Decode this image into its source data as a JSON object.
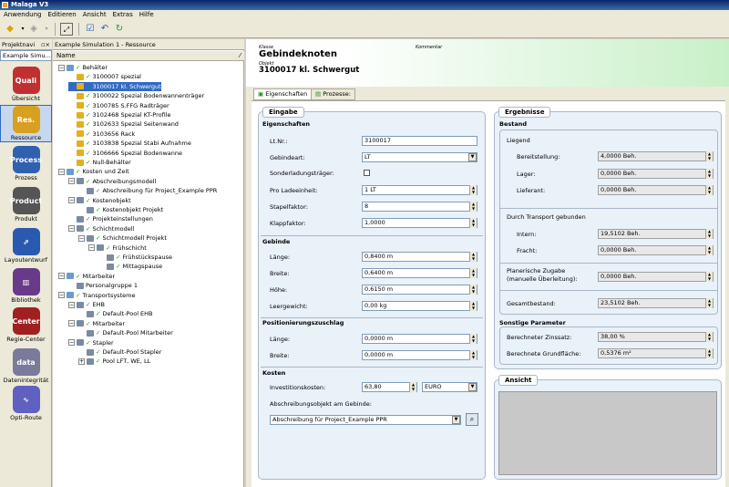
{
  "app": {
    "title": "Malaga V3"
  },
  "menu": [
    "Anwendung",
    "Editieren",
    "Ansicht",
    "Extras",
    "Hilfe"
  ],
  "left": {
    "header": "Projektnavi",
    "subheader": "Example Simu...",
    "nav": [
      {
        "label": "Übersicht",
        "icon": "Quali",
        "color": "#c03030"
      },
      {
        "label": "Ressource",
        "icon": "Res.",
        "color": "#d8a020"
      },
      {
        "label": "Prozess",
        "icon": "Process",
        "color": "#3060b0"
      },
      {
        "label": "Produkt",
        "icon": "Product",
        "color": "#555"
      },
      {
        "label": "Layoutentwurf",
        "icon": "⇗",
        "color": "#2a5ab0"
      },
      {
        "label": "Bibliothek",
        "icon": "▥",
        "color": "#6a3a8a"
      },
      {
        "label": "Regie-Center",
        "icon": "Center",
        "color": "#a02020"
      },
      {
        "label": "Datenintegrität",
        "icon": "data",
        "color": "#7a7a9a"
      },
      {
        "label": "Opti-Route",
        "icon": "∿",
        "color": "#6060c0"
      }
    ]
  },
  "mid": {
    "header": "Example Simulation 1 - Ressource",
    "column": "Name",
    "tree": [
      {
        "t": "Behälter",
        "l": 0,
        "e": "−",
        "c": true
      },
      {
        "t": "3100007 spezial",
        "l": 1,
        "c": true
      },
      {
        "t": "3100017 kl. Schwergut",
        "l": 1,
        "c": true,
        "sel": true
      },
      {
        "t": "3100022 Spezial Bodenwannenträger",
        "l": 1,
        "c": true
      },
      {
        "t": "3100785 S.FFG Radträger",
        "l": 1,
        "c": true
      },
      {
        "t": "3102468 Spezial KT-Profile",
        "l": 1,
        "c": true
      },
      {
        "t": "3102633 Spezial Seitenwand",
        "l": 1,
        "c": true
      },
      {
        "t": "3103656 Rack",
        "l": 1,
        "c": true
      },
      {
        "t": "3103838 Spezial  Stabi Aufnahme",
        "l": 1,
        "c": true
      },
      {
        "t": "3106666 Spezial Bodenwanne",
        "l": 1,
        "c": true
      },
      {
        "t": "Null-Behälter",
        "l": 1,
        "c": true
      },
      {
        "t": "Kosten und Zeit",
        "l": 0,
        "e": "−",
        "c": true
      },
      {
        "t": "Abschreibungsmodell",
        "l": 1,
        "e": "−",
        "c": true
      },
      {
        "t": "Abschreibung für Project_Example PPR",
        "l": 2,
        "c": true
      },
      {
        "t": "Kostenobjekt",
        "l": 1,
        "e": "−",
        "c": true
      },
      {
        "t": "Kostenobjekt Projekt",
        "l": 2,
        "c": true
      },
      {
        "t": "Projekteinstellungen",
        "l": 1,
        "c": true
      },
      {
        "t": "Schichtmodell",
        "l": 1,
        "e": "−",
        "c": true
      },
      {
        "t": "Schichtmodell Projekt",
        "l": 2,
        "e": "−",
        "c": true
      },
      {
        "t": "Frühschicht",
        "l": 3,
        "e": "−",
        "c": true
      },
      {
        "t": "Frühstückspause",
        "l": 4,
        "c": true
      },
      {
        "t": "Mittagspause",
        "l": 4,
        "c": true
      },
      {
        "t": "Mitarbeiter",
        "l": 0,
        "e": "−",
        "c": true
      },
      {
        "t": "Personalgruppe 1",
        "l": 1,
        "c": false
      },
      {
        "t": "Transportsysteme",
        "l": 0,
        "e": "−",
        "c": true
      },
      {
        "t": "EHB",
        "l": 1,
        "e": "−",
        "c": true
      },
      {
        "t": "Default-Pool EHB",
        "l": 2,
        "c": true
      },
      {
        "t": "Mitarbeiter",
        "l": 1,
        "e": "−",
        "c": true
      },
      {
        "t": "Default-Pool Mitarbeiter",
        "l": 2,
        "c": true
      },
      {
        "t": "Stapler",
        "l": 1,
        "e": "−",
        "c": true
      },
      {
        "t": "Default-Pool Stapler",
        "l": 2,
        "c": true
      },
      {
        "t": "Pool LFT, WE, LL",
        "l": 2,
        "e": "+",
        "c": true
      }
    ]
  },
  "header": {
    "klasse": "Klasse",
    "class_name": "Gebindeknoten",
    "objekt": "Objekt",
    "object_name": "3100017 kl. Schwergut",
    "kommentar": "Kommentar"
  },
  "tabs": [
    "Eigenschaften",
    "Prozesse:"
  ],
  "eingabe": {
    "title": "Eingabe",
    "eig": {
      "title": "Eigenschaften",
      "ltnr": {
        "label": "Lt.Nr.:",
        "value": "3100017"
      },
      "gebindeart": {
        "label": "Gebindeart:",
        "value": "LT"
      },
      "sonder": {
        "label": "Sonderladungsträger:"
      },
      "proladeeinheit": {
        "label": "Pro Ladeeinheit:",
        "value": "1 LT"
      },
      "stapelfaktor": {
        "label": "Stapelfaktor:",
        "value": "8"
      },
      "klappfaktor": {
        "label": "Klappfaktor:",
        "value": "1,0000"
      }
    },
    "geb": {
      "title": "Gebinde",
      "laenge": {
        "label": "Länge:",
        "value": "0,8400 m"
      },
      "breite": {
        "label": "Breite:",
        "value": "0,6400 m"
      },
      "hoehe": {
        "label": "Höhe:",
        "value": "0,6150 m"
      },
      "leergewicht": {
        "label": "Leergewicht:",
        "value": "0,00 kg"
      }
    },
    "pos": {
      "title": "Positionierungszuschlag",
      "laenge": {
        "label": "Länge:",
        "value": "0,0000 m"
      },
      "breite": {
        "label": "Breite:",
        "value": "0,0000 m"
      }
    },
    "kosten": {
      "title": "Kosten",
      "invest": {
        "label": "Investitionskosten:",
        "value": "63,80",
        "currency": "EURO"
      },
      "abschr": {
        "label": "Abschreibungsobjekt am Gebinde:",
        "value": "Abschreibung für Project_Example PPR"
      }
    }
  },
  "ergebnisse": {
    "title": "Ergebnisse",
    "bestand": {
      "title": "Bestand",
      "liegend": "Liegend",
      "bereit": {
        "label": "Bereitstellung:",
        "value": "4,0000 Beh."
      },
      "lager": {
        "label": "Lager:",
        "value": "0,0000 Beh."
      },
      "lieferant": {
        "label": "Lieferant:",
        "value": "0,0000 Beh."
      },
      "transport": "Durch Transport gebunden",
      "intern": {
        "label": "Intern:",
        "value": "19,5102 Beh."
      },
      "fracht": {
        "label": "Fracht:",
        "value": "0,0000 Beh."
      },
      "planerisch1": "Planerische Zugabe",
      "planerisch2": "(manuelle Überleitung):",
      "planerisch_value": "0,0000 Beh.",
      "gesamt": {
        "label": "Gesamtbestand:",
        "value": "23,5102 Beh."
      }
    },
    "sonstige": {
      "title": "Sonstige Parameter",
      "zins": {
        "label": "Berechneter Zinssatz:",
        "value": "38,00 %"
      },
      "grund": {
        "label": "Berechnete Grundfläche:",
        "value": "0,5376 m²"
      }
    }
  },
  "ansicht": {
    "title": "Ansicht"
  }
}
